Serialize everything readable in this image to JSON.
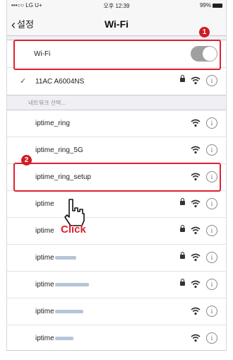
{
  "status_bar": {
    "carrier": "•••○○ LG U+",
    "time": "오후 12:39",
    "battery": "99%"
  },
  "nav": {
    "back_label": "설정",
    "title": "Wi-Fi"
  },
  "wifi_toggle": {
    "label": "Wi-Fi",
    "state": "on"
  },
  "connected_network": {
    "name": "11AC A6004NS",
    "secured": true
  },
  "section_header": "네트워크 선택...",
  "networks": [
    {
      "prefix": "iptime_ring",
      "locked": false
    },
    {
      "prefix": "iptime_ring_5G",
      "locked": false
    },
    {
      "prefix": "iptime_ring_setup",
      "locked": false
    },
    {
      "prefix": "iptime",
      "locked": true
    },
    {
      "prefix": "iptime",
      "locked": true
    },
    {
      "prefix": "iptime",
      "locked": true
    },
    {
      "prefix": "iptime",
      "locked": true
    },
    {
      "prefix": "iptime",
      "locked": false
    },
    {
      "prefix": "iptime",
      "locked": false
    }
  ],
  "annotations": {
    "badge1": "1",
    "badge2": "2",
    "click_label": "Click",
    "highlight_color": "#e0202e"
  },
  "icons": {
    "info": "i"
  }
}
